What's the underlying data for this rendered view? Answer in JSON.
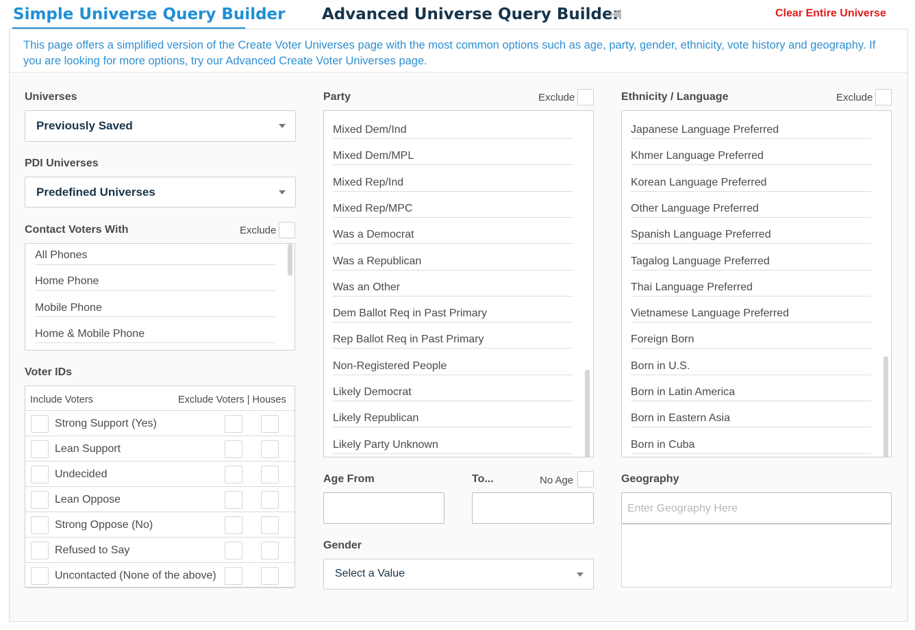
{
  "tabs": {
    "simple": "Simple Universe Query Builder",
    "advanced": "Advanced Universe Query Builder",
    "pin_icon": "pin-icon"
  },
  "clear_universe": "Clear Entire Universe",
  "intro": "This page offers a simplified version of the Create Voter Universes page with the most common options such as age, party, gender, ethnicity, vote history and geography. If you are looking for more options, try our Advanced Create Voter Universes page.",
  "universes": {
    "label": "Universes",
    "value": "Previously Saved"
  },
  "pdi_universes": {
    "label": "PDI Universes",
    "value": "Predefined Universes"
  },
  "contact": {
    "label": "Contact Voters With",
    "exclude": "Exclude",
    "items": [
      "All Phones",
      "Home Phone",
      "Mobile Phone",
      "Home & Mobile Phone"
    ]
  },
  "voter_ids": {
    "label": "Voter IDs",
    "include_header": "Include Voters",
    "exclude_header": "Exclude Voters | Houses",
    "rows": [
      "Strong Support (Yes)",
      "Lean Support",
      "Undecided",
      "Lean Oppose",
      "Strong Oppose (No)",
      "Refused to Say",
      "Uncontacted (None of the above)"
    ]
  },
  "party": {
    "label": "Party",
    "exclude": "Exclude",
    "items": [
      "Mixed Dem/Ind",
      "Mixed Dem/MPL",
      "Mixed Rep/Ind",
      "Mixed Rep/MPC",
      "Was a Democrat",
      "Was a Republican",
      "Was an Other",
      "Dem Ballot Req in Past Primary",
      "Rep Ballot Req in Past Primary",
      "Non-Registered People",
      "Likely Democrat",
      "Likely Republican",
      "Likely Party Unknown"
    ]
  },
  "ethnicity": {
    "label": "Ethnicity / Language",
    "exclude": "Exclude",
    "items": [
      "Japanese Language Preferred",
      "Khmer Language Preferred",
      "Korean Language Preferred",
      "Other Language Preferred",
      "Spanish Language Preferred",
      "Tagalog Language Preferred",
      "Thai Language Preferred",
      "Vietnamese Language Preferred",
      "Foreign Born",
      "Born in U.S.",
      "Born in Latin America",
      "Born in Eastern Asia",
      "Born in Cuba"
    ]
  },
  "age": {
    "from_label": "Age From",
    "to_label": "To...",
    "no_age_label": "No Age"
  },
  "gender": {
    "label": "Gender",
    "value": "Select a Value"
  },
  "geography": {
    "label": "Geography",
    "placeholder": "Enter Geography Here"
  }
}
